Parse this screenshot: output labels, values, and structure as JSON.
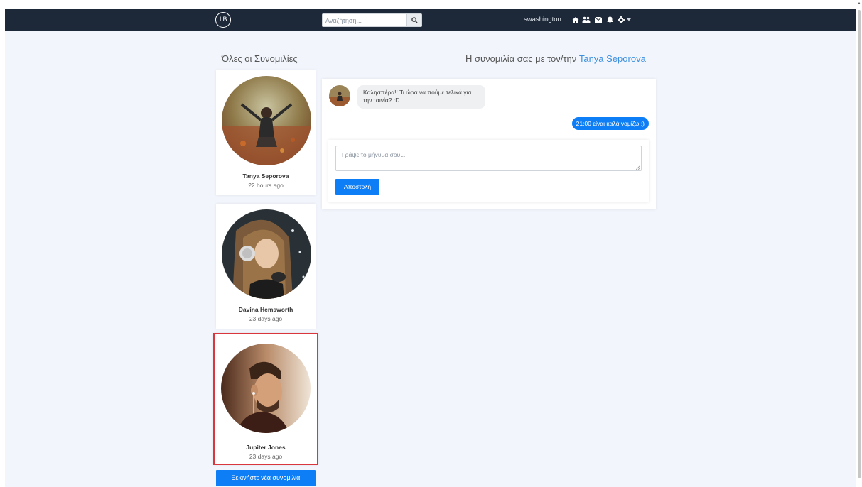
{
  "navbar": {
    "logo_text": "LB",
    "search_placeholder": "Αναζήτηση...",
    "username": "swashington",
    "icons": [
      "search-icon",
      "home-icon",
      "friends-icon",
      "envelope-icon",
      "bell-icon",
      "gear-icon",
      "caret-down-icon"
    ]
  },
  "conversations": {
    "heading": "Όλες οι Συνομιλίες",
    "items": [
      {
        "name": "Tanya Seporova",
        "time": "22 hours ago"
      },
      {
        "name": "Davina Hemsworth",
        "time": "23 days ago"
      },
      {
        "name": "Jupiter Jones",
        "time": "23 days ago"
      }
    ],
    "new_conversation_label": "Ξεκινήστε νέα συνομιλία"
  },
  "chat": {
    "heading_prefix": "Η συνομιλία σας με τον/την ",
    "partner_name": "Tanya Seporova",
    "messages": [
      {
        "direction": "incoming",
        "text": "Καλησπέρα!! Τι ώρα να πούμε τελικά για την ταινία? :D"
      },
      {
        "direction": "outgoing",
        "text": "21:00 είναι καλά νομίζω ;)"
      }
    ],
    "compose_placeholder": "Γράψε το μήνυμα σου...",
    "send_label": "Αποστολή"
  },
  "colors": {
    "navbar": "#1d2838",
    "page_background": "#f2f6fc",
    "primary": "#0d7ef5",
    "link": "#3d8fde",
    "selected_border": "#d9363e"
  }
}
